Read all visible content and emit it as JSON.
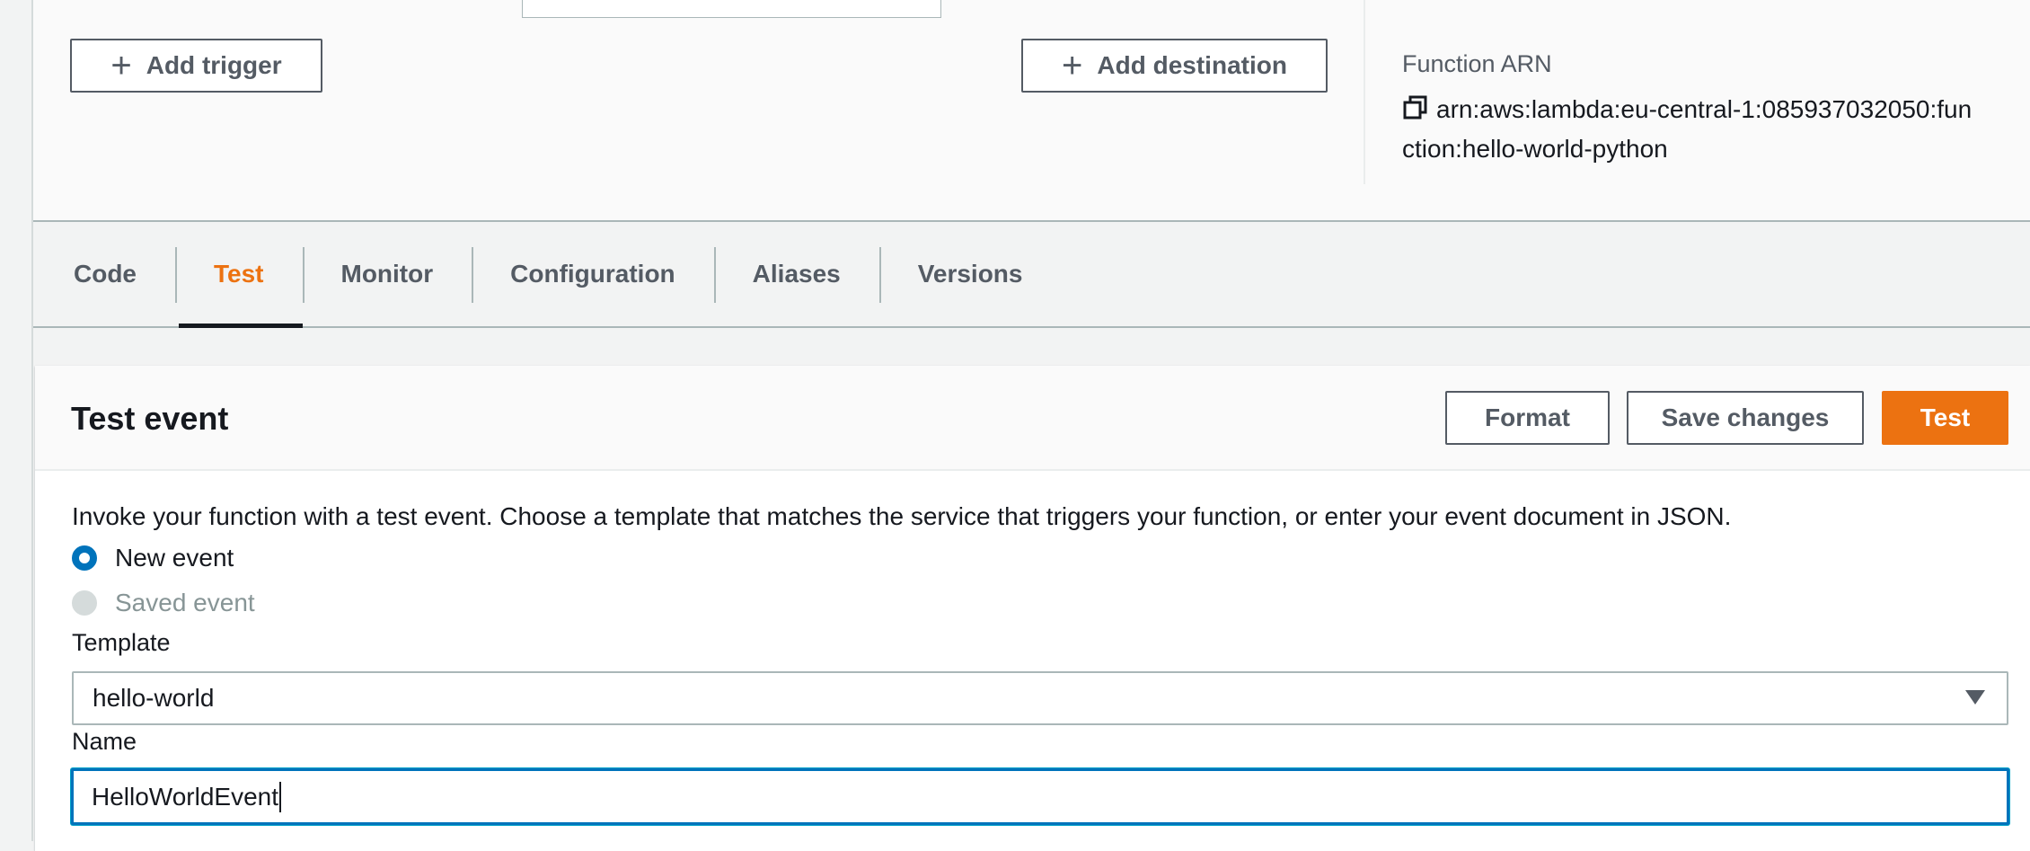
{
  "overview": {
    "add_trigger_label": "Add trigger",
    "add_destination_label": "Add destination",
    "function_arn_label": "Function ARN",
    "function_arn_line1": "arn:aws:lambda:eu-central-1:085937032050:fun",
    "function_arn_line2": "ction:hello-world-python"
  },
  "tabs": [
    {
      "label": "Code",
      "active": false
    },
    {
      "label": "Test",
      "active": true
    },
    {
      "label": "Monitor",
      "active": false
    },
    {
      "label": "Configuration",
      "active": false
    },
    {
      "label": "Aliases",
      "active": false
    },
    {
      "label": "Versions",
      "active": false
    }
  ],
  "test_event": {
    "title": "Test event",
    "format_label": "Format",
    "save_label": "Save changes",
    "test_label": "Test",
    "description": "Invoke your function with a test event. Choose a template that matches the service that triggers your function, or enter your event document in JSON.",
    "radio_new_label": "New event",
    "radio_saved_label": "Saved event",
    "selected_radio": "New event",
    "template_label": "Template",
    "template_value": "hello-world",
    "name_label": "Name",
    "name_value": "HelloWorldEvent"
  },
  "colors": {
    "accent_orange": "#ec7211",
    "focus_blue": "#0073bb",
    "text_dark": "#16191f",
    "text_secondary": "#545b64",
    "disabled_gray": "#879596"
  },
  "icons": [
    "plus-icon",
    "copy-icon",
    "caret-down-icon"
  ]
}
